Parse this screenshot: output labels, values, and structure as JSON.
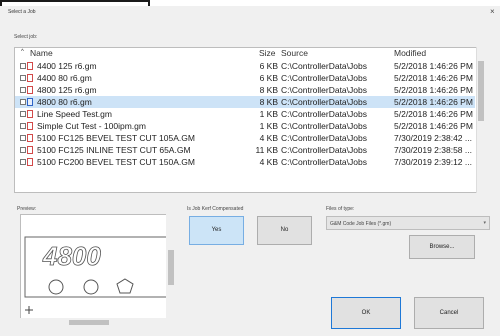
{
  "window": {
    "title": "Select a Job",
    "close_glyph": "×"
  },
  "select_job_label": "Select job:",
  "columns": {
    "sort_glyph": "^",
    "name": "Name",
    "size": "Size",
    "source": "Source",
    "modified": "Modified"
  },
  "files": [
    {
      "name": "4400 125 r6.gm",
      "size": "6 KB",
      "source": "C:\\ControllerData\\Jobs",
      "modified": "5/2/2018 1:46:26 PM"
    },
    {
      "name": "4400 80 r6.gm",
      "size": "6 KB",
      "source": "C:\\ControllerData\\Jobs",
      "modified": "5/2/2018 1:46:26 PM"
    },
    {
      "name": "4800 125 r6.gm",
      "size": "8 KB",
      "source": "C:\\ControllerData\\Jobs",
      "modified": "5/2/2018 1:46:26 PM"
    },
    {
      "name": "4800 80 r6.gm",
      "size": "8 KB",
      "source": "C:\\ControllerData\\Jobs",
      "modified": "5/2/2018 1:46:26 PM",
      "selected": true
    },
    {
      "name": "Line Speed Test.gm",
      "size": "1 KB",
      "source": "C:\\ControllerData\\Jobs",
      "modified": "5/2/2018 1:46:26 PM"
    },
    {
      "name": "Simple Cut Test - 100ipm.gm",
      "size": "1 KB",
      "source": "C:\\ControllerData\\Jobs",
      "modified": "5/2/2018 1:46:26 PM"
    },
    {
      "name": "5100 FC125 BEVEL TEST CUT 105A.GM",
      "size": "4 KB",
      "source": "C:\\ControllerData\\Jobs",
      "modified": "7/30/2019 2:38:42 ..."
    },
    {
      "name": "5100 FC125 INLINE TEST CUT 65A.GM",
      "size": "11 KB",
      "source": "C:\\ControllerData\\Jobs",
      "modified": "7/30/2019 2:38:58 ..."
    },
    {
      "name": "5100 FC200 BEVEL TEST CUT 150A.GM",
      "size": "4 KB",
      "source": "C:\\ControllerData\\Jobs",
      "modified": "7/30/2019 2:39:12 ..."
    }
  ],
  "preview": {
    "label": "Preview:",
    "text": "4800"
  },
  "kerf": {
    "label": "Is Job Kerf Compensated",
    "yes": "Yes",
    "no": "No"
  },
  "file_type": {
    "label": "Files of type:",
    "value": "G&M Code Job Files (*.gm)",
    "browse": "Browse..."
  },
  "actions": {
    "ok": "OK",
    "cancel": "Cancel"
  },
  "colors": {
    "selection": "#cde3f7",
    "yes_button": "#cce4f7"
  }
}
